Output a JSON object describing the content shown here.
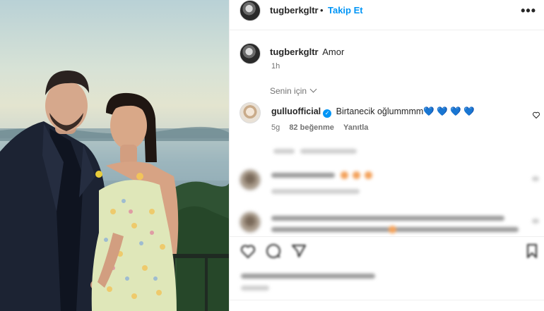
{
  "header": {
    "username": "tugberkgltr",
    "separator": "•",
    "follow_label": "Takip Et",
    "more_label": "•••"
  },
  "caption": {
    "username": "tugberkgltr",
    "text": "Amor",
    "time": "1h"
  },
  "sort": {
    "label": "Senin için"
  },
  "comment": {
    "username": "gulluofficial",
    "text": "Birtanecik oğlummmm💙 💙 💙 💙",
    "time": "5g",
    "likes": "82 beğenme",
    "reply_label": "Yanıtla"
  },
  "colors": {
    "accent": "#0095f6",
    "text_primary": "#262626",
    "text_secondary": "#737373",
    "heart_blue": "#2f6fe0"
  },
  "icons": {
    "more": "more-horizontal-icon",
    "chevron": "chevron-down-icon",
    "verified": "verified-badge-icon",
    "like": "heart-icon",
    "comment": "comment-icon",
    "share": "share-icon",
    "save": "bookmark-icon"
  }
}
